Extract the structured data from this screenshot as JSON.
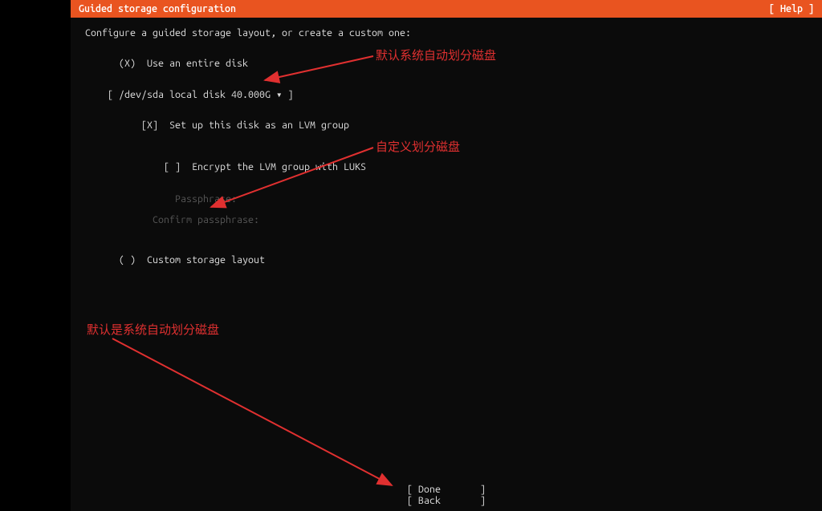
{
  "header": {
    "title": "Guided storage configuration",
    "help": "[ Help ]"
  },
  "prompt": "Configure a guided storage layout, or create a custom one:",
  "opt_entire_radio": "(X)",
  "opt_entire_label": "Use an entire disk",
  "disk_selector": "[ /dev/sda local disk 40.000G ▾ ]",
  "lvm_check": "[X]",
  "lvm_label": "Set up this disk as an LVM group",
  "luks_check": "[ ]",
  "luks_label": "Encrypt the LVM group with LUKS",
  "passphrase_label": "Passphrase:",
  "confirm_passphrase_label": "Confirm passphrase:",
  "opt_custom_radio": "( )",
  "opt_custom_label": "Custom storage layout",
  "footer": {
    "done": "[ Done       ]",
    "back": "[ Back       ]"
  },
  "annotations": {
    "a1": "默认系统自动划分磁盘",
    "a2": "自定义划分磁盘",
    "a3": "默认是系统自动划分磁盘"
  }
}
